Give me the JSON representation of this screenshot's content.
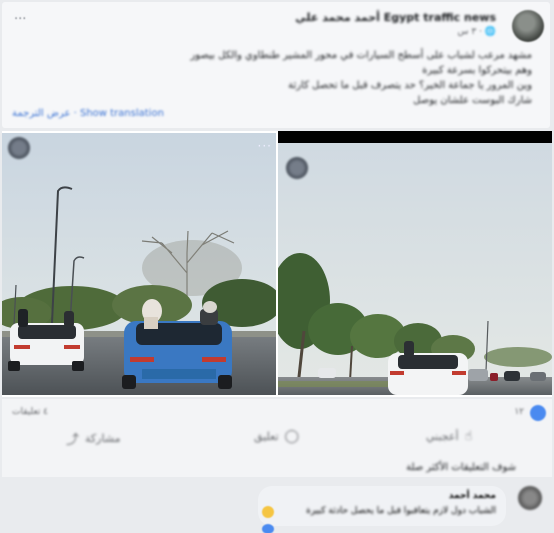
{
  "post": {
    "author": "أحمد محمد علي Egypt traffic news",
    "meta": "٣ س · 🌐",
    "body_lines": [
      "مشهد مرعب لشباب على أسطح السيارات في محور المشير طنطاوي والكل بيصور",
      "وهم بيتحركوا بسرعة كبيرة",
      "وين المرور يا جماعة الخير؟ حد يتصرف قبل ما تحصل كارثة",
      "شارك البوست علشان يوصل"
    ],
    "see_more": "عرض الترجمة · Show translation",
    "menu_label": "···"
  },
  "gallery": {
    "overflow_dots": "···"
  },
  "actions": {
    "reaction_count": "١٢",
    "comment_count": "٤ تعليقات",
    "like": "أعجبني",
    "comment": "تعليق",
    "share": "مشاركة"
  },
  "comments": {
    "top_line": "شوف التعليقات الأكثر صلة",
    "first_name": "محمد أحمد",
    "first_body": "الشباب دول لازم يتعاقبوا قبل ما يحصل حادثة كبيرة"
  },
  "colors": {
    "link": "#3b73d3",
    "sky": "#cdd9e3",
    "road": "#5e6368",
    "blue_car": "#3a78c2"
  }
}
